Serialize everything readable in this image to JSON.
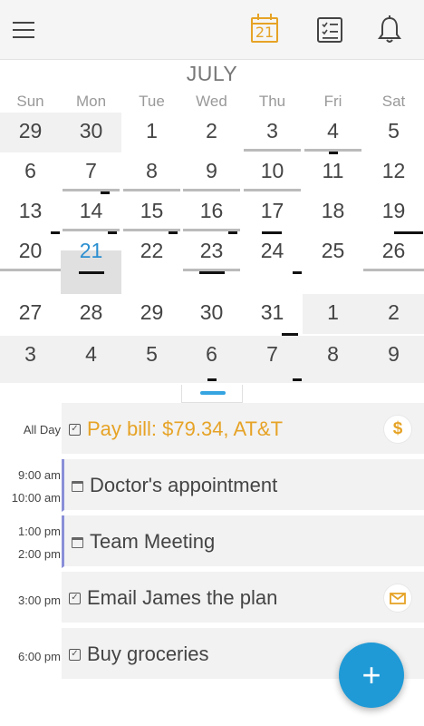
{
  "toolbar": {
    "calendar_day": "21"
  },
  "calendar": {
    "month": "JULY",
    "weekdays": [
      "Sun",
      "Mon",
      "Tue",
      "Wed",
      "Thu",
      "Fri",
      "Sat"
    ],
    "weeks": [
      [
        "29",
        "30",
        "1",
        "2",
        "3",
        "4",
        "5"
      ],
      [
        "6",
        "7",
        "8",
        "9",
        "10",
        "11",
        "12"
      ],
      [
        "13",
        "14",
        "15",
        "16",
        "17",
        "18",
        "19"
      ],
      [
        "20",
        "21",
        "22",
        "23",
        "24",
        "25",
        "26"
      ],
      [
        "27",
        "28",
        "29",
        "30",
        "31",
        "1",
        "2"
      ],
      [
        "3",
        "4",
        "5",
        "6",
        "7",
        "8",
        "9"
      ]
    ],
    "selected_day": "21",
    "accent": "#2b8fd0"
  },
  "agenda": {
    "items": [
      {
        "time_start": "All Day",
        "time_end": "",
        "title": "Pay bill: $79.34, AT&T",
        "kind": "task",
        "badge": "$",
        "color": "#e6a326"
      },
      {
        "time_start": "9:00 am",
        "time_end": "10:00 am",
        "title": "Doctor's appointment",
        "kind": "event",
        "badge": "",
        "color": "#8a8fd8"
      },
      {
        "time_start": "1:00 pm",
        "time_end": "2:00 pm",
        "title": "Team Meeting",
        "kind": "event",
        "badge": "",
        "color": "#8a8fd8"
      },
      {
        "time_start": "3:00 pm",
        "time_end": "",
        "title": "Email James the plan",
        "kind": "task",
        "badge": "envelope-icon",
        "color": "#e6a326"
      },
      {
        "time_start": "6:00 pm",
        "time_end": "",
        "title": "Buy groceries",
        "kind": "task",
        "badge": "",
        "color": ""
      }
    ]
  },
  "fab": {
    "label": "+"
  }
}
